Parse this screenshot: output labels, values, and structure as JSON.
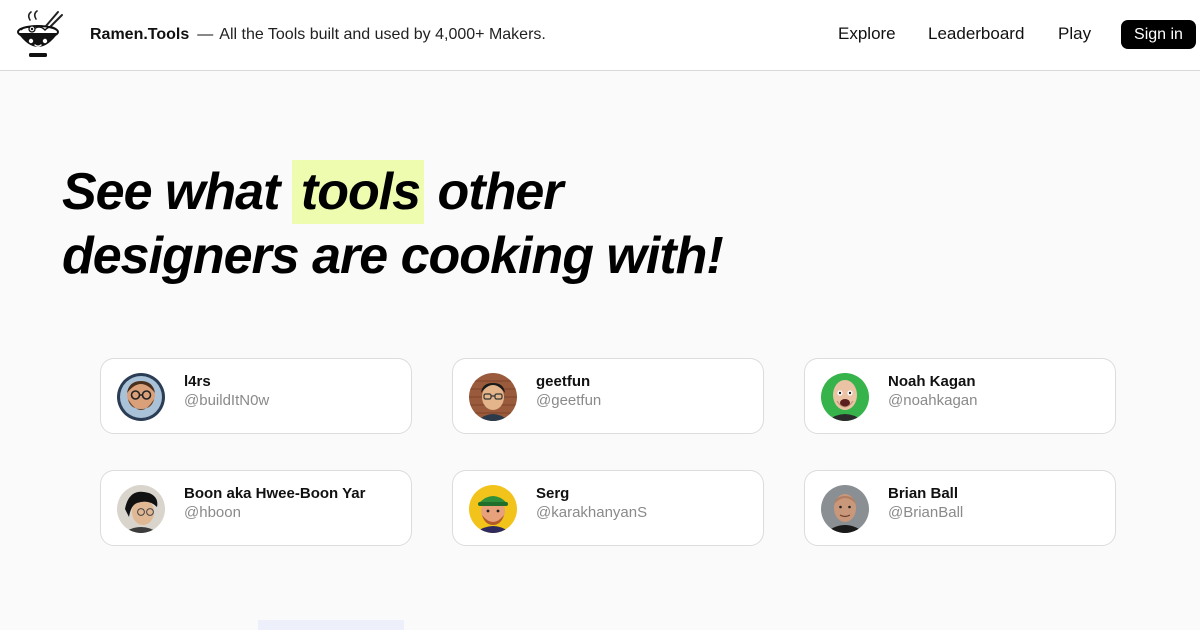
{
  "header": {
    "brand_name": "Ramen.Tools",
    "separator": "—",
    "tagline": "All the Tools built and used by 4,000+ Makers.",
    "nav": [
      "Explore",
      "Leaderboard",
      "Play"
    ],
    "signin_label": "Sign in"
  },
  "hero": {
    "line1_before": "See what ",
    "line1_highlight": "tools",
    "line1_after": " other",
    "line2_bold": "designers",
    "line2_after": " are cooking with!",
    "highlight_color": "#eefcb0"
  },
  "makers": [
    {
      "name": "l4rs",
      "handle": "@buildItN0w",
      "avatar": "bearded-man-glasses-avatar"
    },
    {
      "name": "geetfun",
      "handle": "@geetfun",
      "avatar": "man-glasses-avatar"
    },
    {
      "name": "Noah Kagan",
      "handle": "@noahkagan",
      "avatar": "bald-man-green-bg-avatar"
    },
    {
      "name": "Boon aka Hwee-Boon Yar",
      "handle": "@hboon",
      "avatar": "man-dark-hair-avatar"
    },
    {
      "name": "Serg",
      "handle": "@karakhanyanS",
      "avatar": "man-green-cap-yellow-bg-avatar"
    },
    {
      "name": "Brian Ball",
      "handle": "@BrianBall",
      "avatar": "bald-man-grey-bg-avatar"
    }
  ]
}
